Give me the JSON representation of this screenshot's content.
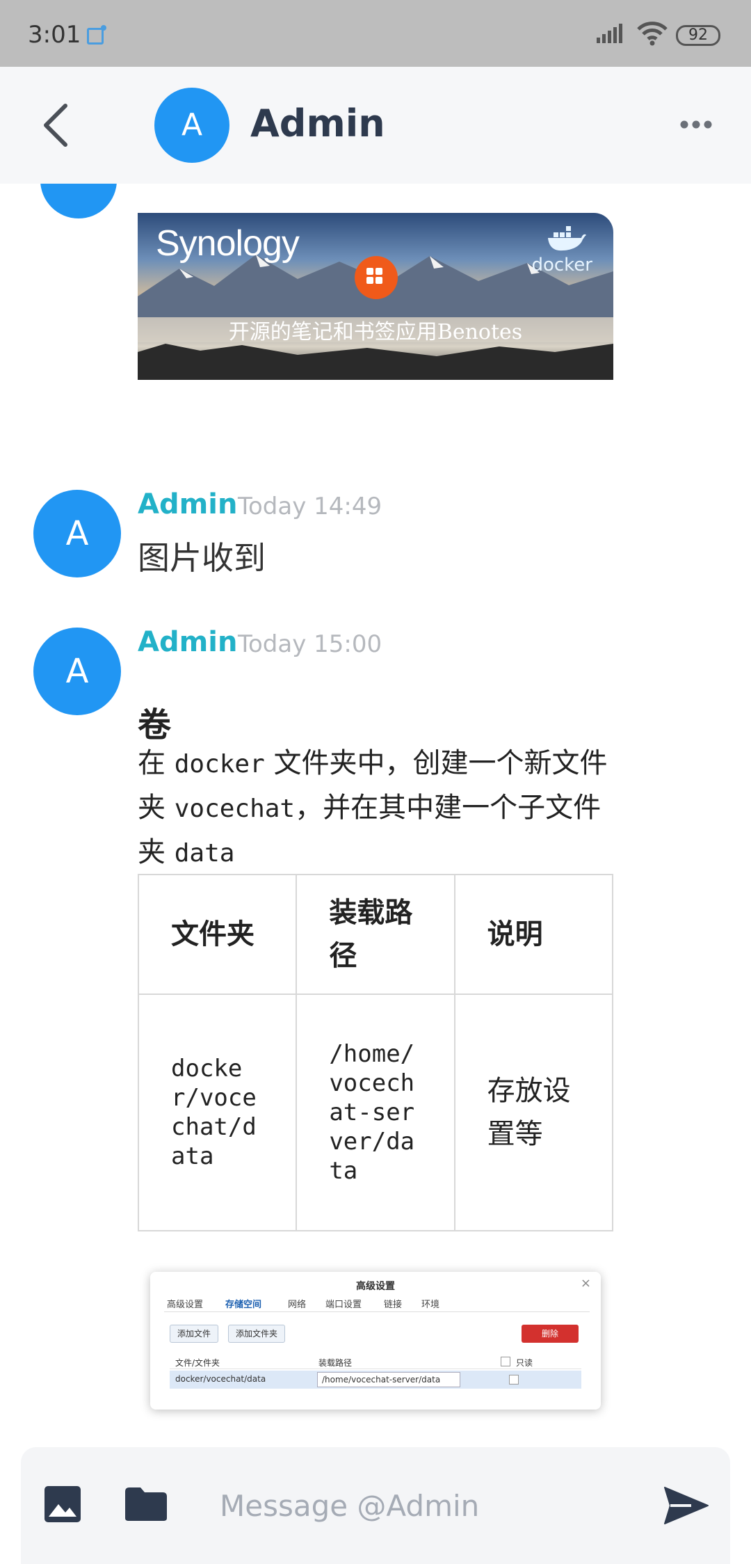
{
  "status_bar": {
    "time": "3:01",
    "battery": "92"
  },
  "header": {
    "avatar_letter": "A",
    "title": "Admin"
  },
  "banner": {
    "brand": "Synology",
    "docker_text": "docker",
    "caption": "开源的笔记和书签应用Benotes"
  },
  "messages": [
    {
      "avatar_letter": "A",
      "author": "Admin",
      "time": "Today 14:49",
      "text": "图片收到"
    },
    {
      "avatar_letter": "A",
      "author": "Admin",
      "time": "Today 15:00",
      "heading": "卷",
      "para_1": "在 ",
      "para_code_1": "docker",
      "para_2": " 文件夹中，创建一个新文件夹 ",
      "para_code_2": "vocechat",
      "para_3": "，并在其中建一个子文件夹 ",
      "para_code_3": "data",
      "table": {
        "headers": [
          "文件夹",
          "装载路径",
          "说明"
        ],
        "row": [
          "docker/vocechat/data",
          "/home/vocechat-server/data",
          "存放设置等"
        ]
      }
    }
  ],
  "dialog": {
    "title": "高级设置",
    "tabs": [
      "高级设置",
      "存储空间",
      "网络",
      "端口设置",
      "链接",
      "环境"
    ],
    "add_file": "添加文件",
    "add_folder": "添加文件夹",
    "delete": "删除",
    "col_folder": "文件/文件夹",
    "col_mount": "装载路径",
    "col_readonly": "只读",
    "row_folder": "docker/vocechat/data",
    "row_mount": "/home/vocechat-server/data"
  },
  "composer": {
    "placeholder": "Message @Admin"
  }
}
